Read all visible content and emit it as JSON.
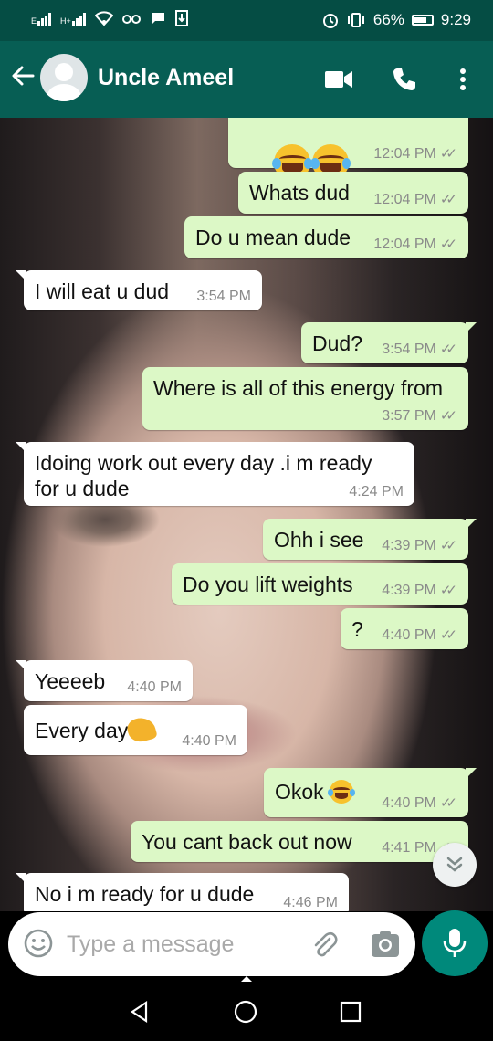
{
  "status_bar": {
    "network_1": "E",
    "network_2": "H+",
    "battery_percent": "66%",
    "time": "9:29"
  },
  "header": {
    "contact_name": "Uncle Ameel",
    "icons": [
      "back-arrow-icon",
      "avatar",
      "video-call-icon",
      "phone-icon",
      "more-vert-icon"
    ]
  },
  "messages": [
    {
      "dir": "out",
      "text": "",
      "emoji": "joy-joy",
      "time": "12:04 PM",
      "ticks": "✓✓"
    },
    {
      "dir": "out",
      "text": "Whats dud",
      "time": "12:04 PM",
      "ticks": "✓✓"
    },
    {
      "dir": "out",
      "text": "Do u mean dude",
      "time": "12:04 PM",
      "ticks": "✓✓"
    },
    {
      "dir": "in",
      "text": "I will eat u dud",
      "time": "3:54 PM"
    },
    {
      "dir": "out",
      "text": "Dud?",
      "time": "3:54 PM",
      "ticks": "✓✓"
    },
    {
      "dir": "out",
      "text": "Where is all of this energy from",
      "time": "3:57 PM",
      "ticks": "✓✓"
    },
    {
      "dir": "in",
      "text": "Idoing work out every day .i m ready\nfor u dude",
      "time": "4:24 PM"
    },
    {
      "dir": "out",
      "text": "Ohh i see",
      "time": "4:39 PM",
      "ticks": "✓✓"
    },
    {
      "dir": "out",
      "text": "Do you lift weights",
      "time": "4:39 PM",
      "ticks": "✓✓"
    },
    {
      "dir": "out",
      "text": "?",
      "time": "4:40 PM",
      "ticks": "✓✓"
    },
    {
      "dir": "in",
      "text": "Yeeeeb",
      "time": "4:40 PM"
    },
    {
      "dir": "in",
      "text": "Every day",
      "emoji": "flexed-biceps",
      "time": "4:40 PM"
    },
    {
      "dir": "out",
      "text": "Okok",
      "emoji": "joy",
      "time": "4:40 PM",
      "ticks": "✓✓"
    },
    {
      "dir": "out",
      "text": "You cant back out now",
      "time": "4:41 PM",
      "ticks": "✓✓"
    },
    {
      "dir": "in",
      "text": "No i m ready for u dude",
      "time": "4:46 PM"
    }
  ],
  "composer": {
    "placeholder": "Type a message",
    "icons": [
      "emoji-icon",
      "attach-icon",
      "camera-icon",
      "mic-icon"
    ]
  },
  "nav": {
    "icons": [
      "back-triangle-icon",
      "home-circle-icon",
      "recents-square-icon"
    ]
  },
  "colors": {
    "header": "#075e54",
    "status": "#054d44",
    "outgoing": "#dcf8c6",
    "incoming": "#ffffff",
    "accent": "#00897b"
  }
}
